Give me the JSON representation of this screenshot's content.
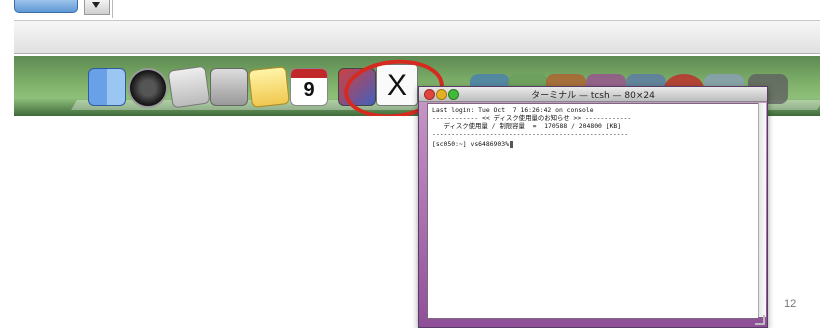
{
  "terminal": {
    "title": "ターミナル — tcsh — 80×24",
    "lines": [
      "Last login: Tue Oct  7 16:26:42 on console",
      "------------ << ディスク使用量のお知らせ >> ------------",
      "   ディスク使用量 / 制限容量  =  170588 / 204800 [KB]",
      "---------------------------------------------------",
      "[sc050:~] vs6486903%"
    ]
  },
  "dock": {
    "calendar_day": "9",
    "x11_label": "X",
    "icons": [
      "finder-icon",
      "dashboard-icon",
      "preview-icon",
      "calculator-icon",
      "notes-icon",
      "ical-icon",
      "transfer-icon",
      "x11-icon"
    ]
  },
  "page_number": "12",
  "colors": {
    "highlight_ring": "#d62a1f",
    "terminal_frame": "#8f4f98",
    "dock_green": "#7eb06a"
  }
}
